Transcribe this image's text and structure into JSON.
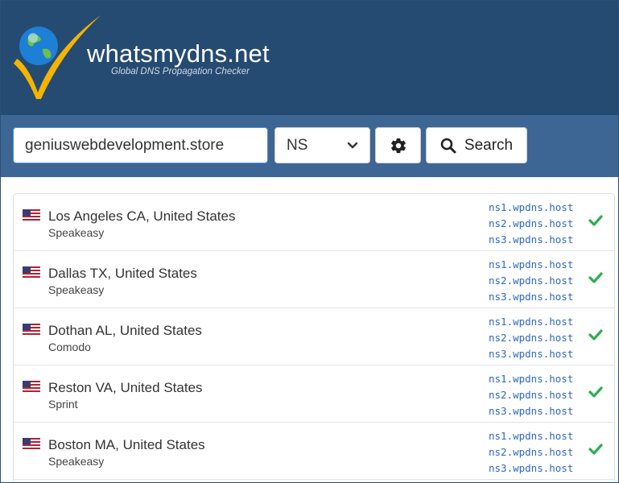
{
  "header": {
    "brand": "whatsmydns.net",
    "tagline": "Global DNS Propagation Checker",
    "logo_icon": "globe-check-logo"
  },
  "search": {
    "domain_value": "geniuswebdevelopment.store",
    "record_type": "NS",
    "settings_icon": "gear-icon",
    "search_label": "Search",
    "search_icon": "magnifier-icon"
  },
  "colors": {
    "header_bg": "#264b72",
    "searchbar_bg": "#3d6694",
    "ns_link": "#2d68c4",
    "success": "#2eae4f"
  },
  "results": [
    {
      "location": "Los Angeles CA, United States",
      "provider": "Speakeasy",
      "ns": [
        "ns1.wpdns.host",
        "ns2.wpdns.host",
        "ns3.wpdns.host"
      ],
      "status": "ok"
    },
    {
      "location": "Dallas TX, United States",
      "provider": "Speakeasy",
      "ns": [
        "ns1.wpdns.host",
        "ns2.wpdns.host",
        "ns3.wpdns.host"
      ],
      "status": "ok"
    },
    {
      "location": "Dothan AL, United States",
      "provider": "Comodo",
      "ns": [
        "ns1.wpdns.host",
        "ns2.wpdns.host",
        "ns3.wpdns.host"
      ],
      "status": "ok"
    },
    {
      "location": "Reston VA, United States",
      "provider": "Sprint",
      "ns": [
        "ns1.wpdns.host",
        "ns2.wpdns.host",
        "ns3.wpdns.host"
      ],
      "status": "ok"
    },
    {
      "location": "Boston MA, United States",
      "provider": "Speakeasy",
      "ns": [
        "ns1.wpdns.host",
        "ns2.wpdns.host",
        "ns3.wpdns.host"
      ],
      "status": "ok"
    }
  ]
}
